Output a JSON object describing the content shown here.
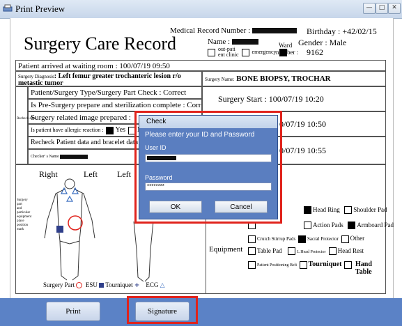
{
  "window": {
    "title": "Print Preview",
    "min": "—",
    "max": "□",
    "close": "✕"
  },
  "header": {
    "title": "Surgery Care Record",
    "mrn_label": "Medical Record Number :",
    "birthday_label": "Birthday",
    "birthday_value": ": +42/02/15",
    "name_label": "Name :",
    "gender_label": "Gender",
    "gender_value": ": Male",
    "outpatient_label": "out-pati\nent clinic",
    "emergency_label": "emergency",
    "ward_label": "Ward",
    "number_label": "number :",
    "number_value": "9162"
  },
  "record": {
    "arrival": "Patient arrived at waiting room : 100/07/19 09:50",
    "diagnosis_label": "Surgery Diagnosis",
    "diagnosis_value": ": Left femur greater trochanteric lesion r/o metastic tumor",
    "surgery_name_label": "Surgery Name:",
    "surgery_name_value": "BONE BIOPSY, TROCHAR",
    "check_type": "Patient/Surgery Type/Surgery Part Check : Correct",
    "prep": "Is Pre-Surgery prepare and sterilization complete : Correct",
    "image_prepared": "Surgery related image prepared :",
    "recheck_small": "Recheck data",
    "allergy": "Is patient have allergic reaction :",
    "allergy_yes": "Yes",
    "allergy_no": "No",
    "recheck_bracelet": "Recheck Patient data and bracelet data co",
    "checker": "Checker' s Name",
    "surgery_start": "Surgery Start : 100/07/19 10:20",
    "time2": "0/07/19 10:50",
    "time3": "0/07/19 10:55",
    "right": "Right",
    "left": "Left",
    "left2": "Left",
    "surgery_part_small": "Surgery part and particular equipment place position mark",
    "legend_part": "Surgery Part",
    "legend_esu": "ESU",
    "legend_tourniquet": "Tourniquet",
    "legend_ecg": "ECG",
    "equipment_label": "Equipment",
    "eq_head_ring": "Head Ring",
    "eq_shoulder_pad": "Shoulder Pad",
    "eq_action_pads": "Action Pads",
    "eq_armboard_pad": "Armboard Pad",
    "eq_crutch": "Crutch Stirrup Pads",
    "eq_sacral": "Sacral Protector",
    "eq_other": "Other",
    "eq_table_pad": "Table Pad",
    "eq_l_head": "L Head Protector",
    "eq_head_rest": "Head Rest",
    "eq_positioning_belt": "Patient Positioning Belt",
    "eq_tourniquet": "Tourniquet",
    "eq_hand_table": "Hand Table"
  },
  "dialog": {
    "title": "Check",
    "message": "Please enter your ID and Password",
    "user_id_label": "User ID",
    "password_label": "Password",
    "password_value": "********",
    "ok": "OK",
    "cancel": "Cancel"
  },
  "footer": {
    "print": "Print",
    "signature": "Signature"
  },
  "colors": {
    "accent": "#5b82c6",
    "highlight": "#e0231c",
    "dialog": "#5a7ec0"
  }
}
